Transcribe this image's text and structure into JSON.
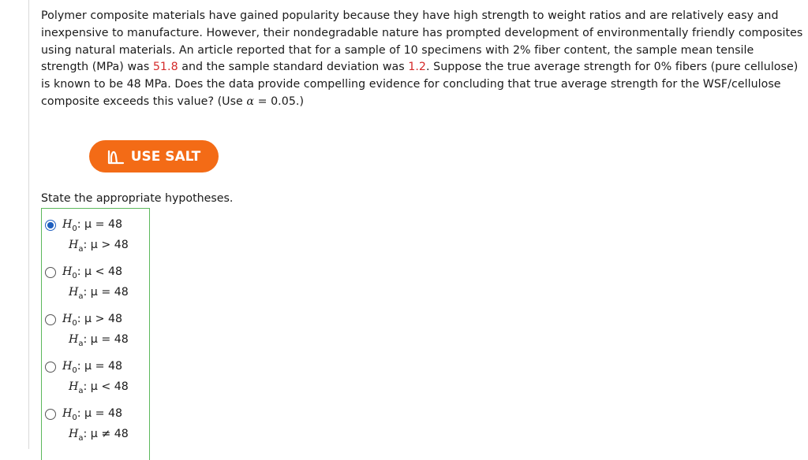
{
  "problem": {
    "text_1": "Polymer composite materials have gained popularity because they have high strength to weight ratios and are relatively easy and inexpensive to manufacture. However, their nondegradable nature has prompted development of environmentally friendly composites using natural materials. An article reported that for a sample of 10 specimens with 2% fiber content, the sample mean tensile strength (MPa) was ",
    "mean_value": "51.8",
    "text_2": " and the sample standard deviation was ",
    "sd_value": "1.2",
    "text_3": ". Suppose the true average strength for 0% fibers (pure cellulose) is known to be 48 MPa. Does the data provide compelling evidence for concluding that true average strength for the WSF/cellulose composite exceeds this value? (Use ",
    "alpha_symbol": "α",
    "text_4": " = 0.05.)"
  },
  "salt_button": {
    "label": "USE SALT",
    "icon": "salt-chart-icon",
    "color": "#f36b16"
  },
  "question": {
    "prompt": "State the appropriate hypotheses."
  },
  "options": [
    {
      "h0_symbol": "H",
      "h0_sub": "0",
      "h0_rest": ": μ = 48",
      "ha_symbol": "H",
      "ha_sub": "a",
      "ha_rest": ": μ > 48",
      "selected": true
    },
    {
      "h0_symbol": "H",
      "h0_sub": "0",
      "h0_rest": ": μ < 48",
      "ha_symbol": "H",
      "ha_sub": "a",
      "ha_rest": ": μ = 48",
      "selected": false
    },
    {
      "h0_symbol": "H",
      "h0_sub": "0",
      "h0_rest": ": μ > 48",
      "ha_symbol": "H",
      "ha_sub": "a",
      "ha_rest": ": μ = 48",
      "selected": false
    },
    {
      "h0_symbol": "H",
      "h0_sub": "0",
      "h0_rest": ": μ = 48",
      "ha_symbol": "H",
      "ha_sub": "a",
      "ha_rest": ": μ < 48",
      "selected": false
    },
    {
      "h0_symbol": "H",
      "h0_sub": "0",
      "h0_rest": ": μ = 48",
      "ha_symbol": "H",
      "ha_sub": "a",
      "ha_rest": ": μ ≠ 48",
      "selected": false
    }
  ],
  "colors": {
    "highlight": "#d42a2a",
    "answer_border": "#5cb85c",
    "radio_selected": "#1f5fbf"
  }
}
